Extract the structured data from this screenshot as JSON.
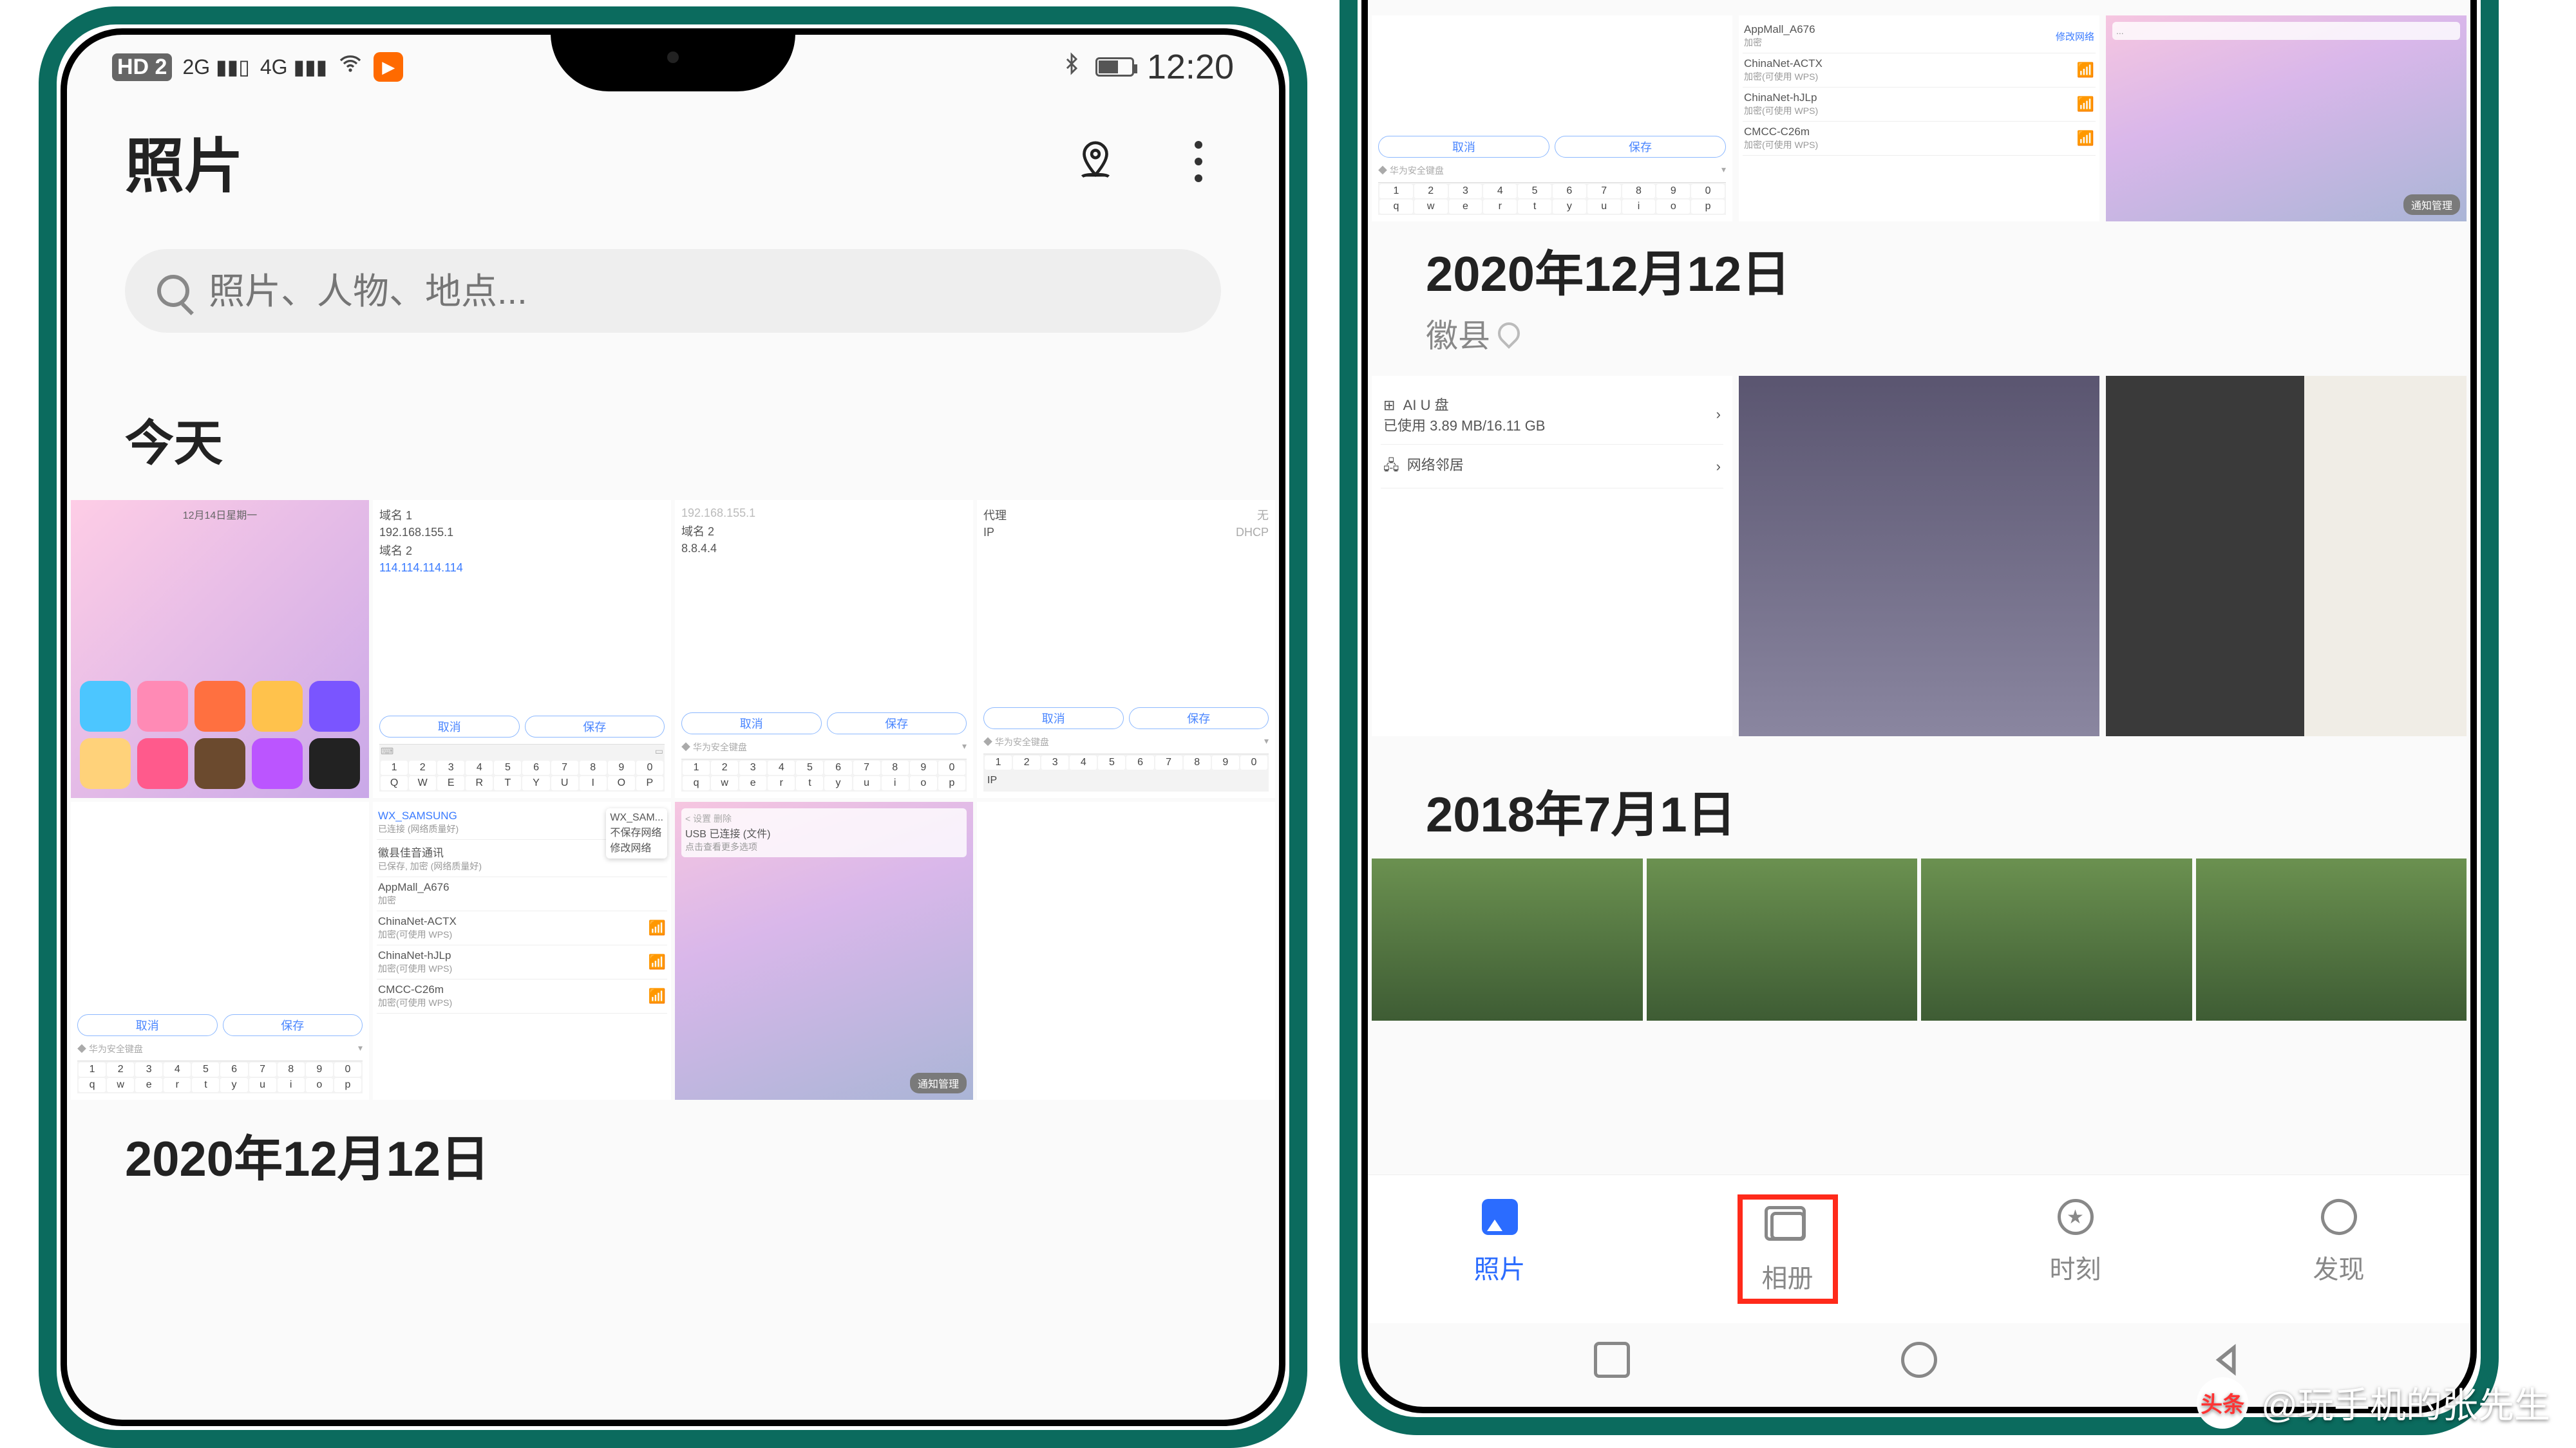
{
  "status": {
    "hd": "HD 2",
    "sig1": "2G",
    "sig2": "4G",
    "time": "12:20"
  },
  "header": {
    "title": "照片"
  },
  "search": {
    "placeholder": "照片、人物、地点..."
  },
  "sections": {
    "today": "今天",
    "d1": "2020年12月12日",
    "d2": "2020年12月12日",
    "d2_loc": "徽县",
    "d3": "2018年7月1日"
  },
  "actions": {
    "cancel": "取消",
    "save": "保存"
  },
  "thumbs": {
    "pinkdate": "12月14日星期一",
    "ip": {
      "dom1": "域名 1",
      "ip1": "192.168.155.1",
      "dom2": "域名 2",
      "ip2": "114.114.114.114",
      "safekbd": "华为安全键盘"
    },
    "ip2": {
      "ip0": "192.168.155.1",
      "dom2": "域名 2",
      "ip2": "8.8.4.4"
    },
    "proxy": {
      "proxy": "代理",
      "none": "无",
      "ip": "IP",
      "dhcp": "DHCP"
    },
    "wifi": {
      "n1": "WX_SAMSUNG",
      "s1": "已连接 (网络质量好)",
      "n2": "徽县佳音通讯",
      "s2": "已保存, 加密 (网络质量好)",
      "n3": "AppMall_A676",
      "s3": "加密",
      "n4": "ChinaNet-ACTX",
      "s4": "加密(可使用 WPS)",
      "n5": "ChinaNet-hJLp",
      "s5": "加密(可使用 WPS)",
      "n6": "CMCC-C26m",
      "s6": "加密(可使用 WPS)",
      "pop1": "WX_SAM...",
      "pop2": "不保存网络",
      "pop3": "修改网络"
    },
    "usb": {
      "path": "< 设置  删除",
      "t": "USB 已连接 (文件)",
      "sub": "点击查看更多选项",
      "chip": "通知管理"
    },
    "kbd_nums": [
      "1",
      "2",
      "3",
      "4",
      "5",
      "6",
      "7",
      "8",
      "9",
      "0"
    ],
    "kbd_q": [
      "q",
      "w",
      "e",
      "r",
      "t",
      "y",
      "u",
      "i",
      "o",
      "p"
    ],
    "kbd_Q": [
      "Q",
      "W",
      "E",
      "R",
      "T",
      "Y",
      "U",
      "I",
      "O",
      "P"
    ],
    "ipword": "IP"
  },
  "right_thumbs": {
    "set": {
      "a": "AI U 盘",
      "a_sub": "已使用 3.89 MB/16.11 GB",
      "b": "网络邻居"
    }
  },
  "nav": {
    "photos": "照片",
    "albums": "相册",
    "moments": "时刻",
    "discover": "发现"
  },
  "watermark": {
    "brand": "头条",
    "handle": "@玩手机的张先生"
  }
}
